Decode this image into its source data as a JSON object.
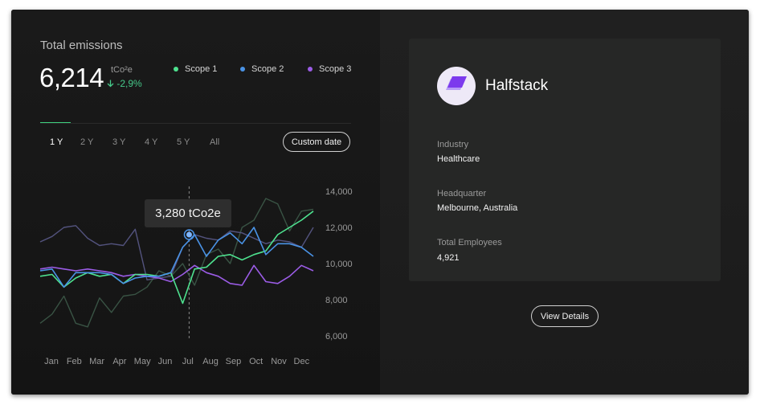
{
  "emissions": {
    "title": "Total emissions",
    "total": "6,214",
    "unit": "tCo²e",
    "change": "-2,9%",
    "legend": [
      {
        "label": "Scope 1",
        "color": "#4ee28f"
      },
      {
        "label": "Scope 2",
        "color": "#4a93e6"
      },
      {
        "label": "Scope 3",
        "color": "#9b5ce6"
      }
    ],
    "ranges": [
      "1 Y",
      "2 Y",
      "3 Y",
      "4 Y",
      "5 Y",
      "All"
    ],
    "active_range": "1 Y",
    "custom_date_label": "Custom date",
    "tooltip": "3,280 tCo2e"
  },
  "chart_data": {
    "type": "line",
    "x": [
      "Jan",
      "Jan",
      "Feb",
      "Feb",
      "Mar",
      "Mar",
      "Apr",
      "Apr",
      "May",
      "May",
      "Jun",
      "Jun",
      "Jul",
      "Jul",
      "Aug",
      "Aug",
      "Sep",
      "Sep",
      "Oct",
      "Oct",
      "Nov",
      "Nov",
      "Dec",
      "Dec"
    ],
    "x_tick_labels": [
      "Jan",
      "Feb",
      "Mar",
      "Apr",
      "May",
      "Jun",
      "Jul",
      "Aug",
      "Sep",
      "Oct",
      "Nov",
      "Dec"
    ],
    "ylim": [
      6000,
      14000
    ],
    "y_ticks": [
      "14,000",
      "12,000",
      "10,000",
      "8,000",
      "6,000"
    ],
    "highlight_month": "Jul",
    "series": [
      {
        "name": "Scope 1",
        "color": "#4ee28f",
        "values": [
          9300,
          9400,
          8700,
          9200,
          9500,
          9300,
          9400,
          8900,
          9400,
          9400,
          9300,
          9500,
          7800,
          9700,
          9800,
          10400,
          10500,
          10200,
          10500,
          10700,
          11600,
          12000,
          12400,
          12900
        ]
      },
      {
        "name": "Scope 2",
        "color": "#4a93e6",
        "values": [
          9600,
          9700,
          8700,
          9500,
          9500,
          9500,
          9400,
          8900,
          9200,
          9300,
          9300,
          9500,
          10900,
          11600,
          10400,
          11300,
          11700,
          11100,
          12000,
          10500,
          11100,
          11100,
          10900,
          10400
        ]
      },
      {
        "name": "Scope 3",
        "color": "#9b5ce6",
        "values": [
          9700,
          9800,
          9700,
          9600,
          9700,
          9600,
          9500,
          9300,
          9400,
          9300,
          9200,
          9000,
          9400,
          9900,
          9500,
          9300,
          8900,
          8800,
          9900,
          9000,
          8900,
          9300,
          9900,
          9600
        ]
      },
      {
        "name": "",
        "color": "#5a5a8a",
        "values": [
          11200,
          11500,
          12000,
          12100,
          11400,
          11000,
          11100,
          11000,
          11900,
          9100,
          9200,
          9300,
          10900,
          11600,
          11400,
          11300,
          11800,
          11700,
          11400,
          11100,
          11300,
          11200,
          10900,
          12000
        ]
      },
      {
        "name": "",
        "color": "#3d5a49",
        "values": [
          6700,
          7200,
          8200,
          6700,
          6500,
          8100,
          7300,
          8200,
          8300,
          8700,
          9600,
          9300,
          10000,
          8800,
          10500,
          10800,
          10000,
          12000,
          12400,
          13600,
          13300,
          11800,
          12900,
          13000
        ]
      }
    ]
  },
  "company": {
    "name": "Halfstack",
    "industry_label": "Industry",
    "industry": "Healthcare",
    "hq_label": "Headquarter",
    "hq": "Melbourne, Australia",
    "employees_label": "Total Employees",
    "employees": "4,921",
    "details_button": "View Details"
  }
}
